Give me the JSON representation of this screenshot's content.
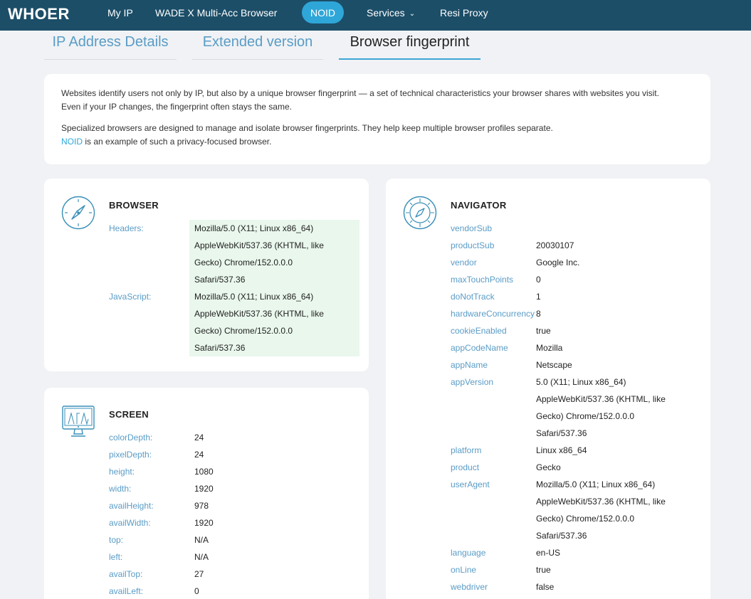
{
  "nav": {
    "logo": "WHOER",
    "links": [
      "My IP",
      "WADE X Multi-Acc Browser",
      "NOID",
      "Services",
      "Resi Proxy"
    ]
  },
  "tabs": [
    "IP Address Details",
    "Extended version",
    "Browser fingerprint"
  ],
  "intro": {
    "p1_line1": "Websites identify users not only by IP, but also by a unique browser fingerprint — a set of technical characteristics your browser shares with websites you visit.",
    "p1_line2": "Even if your IP changes, the fingerprint often stays the same.",
    "p2_line1": "Specialized browsers are designed to manage and isolate browser fingerprints. They help keep multiple browser profiles separate.",
    "p2_link": "NOID",
    "p2_line2_rest": " is an example of such a privacy-focused browser."
  },
  "browser": {
    "title": "BROWSER",
    "headers_label": "Headers:",
    "headers_lines": [
      "Mozilla/5.0 (X11; Linux x86_64)",
      "AppleWebKit/537.36 (KHTML, like",
      "Gecko) Chrome/152.0.0.0",
      "Safari/537.36"
    ],
    "js_label": "JavaScript:",
    "js_lines": [
      "Mozilla/5.0 (X11; Linux x86_64)",
      "AppleWebKit/537.36 (KHTML, like",
      "Gecko) Chrome/152.0.0.0",
      "Safari/537.36"
    ]
  },
  "screen": {
    "title": "SCREEN",
    "rows": [
      {
        "k": "colorDepth:",
        "v": "24"
      },
      {
        "k": "pixelDepth:",
        "v": "24"
      },
      {
        "k": "height:",
        "v": "1080"
      },
      {
        "k": "width:",
        "v": "1920"
      },
      {
        "k": "availHeight:",
        "v": "978"
      },
      {
        "k": "availWidth:",
        "v": "1920"
      },
      {
        "k": "top:",
        "v": "N/A"
      },
      {
        "k": "left:",
        "v": "N/A"
      },
      {
        "k": "availTop:",
        "v": "27"
      },
      {
        "k": "availLeft:",
        "v": "0"
      }
    ]
  },
  "navigator": {
    "title": "NAVIGATOR",
    "rows": [
      {
        "k": "vendorSub",
        "v": ""
      },
      {
        "k": "productSub",
        "v": "20030107"
      },
      {
        "k": "vendor",
        "v": "Google Inc."
      },
      {
        "k": "maxTouchPoints",
        "v": "0"
      },
      {
        "k": "doNotTrack",
        "v": "1"
      },
      {
        "k": "hardwareConcurrency",
        "v": "8"
      },
      {
        "k": "cookieEnabled",
        "v": "true"
      },
      {
        "k": "appCodeName",
        "v": "Mozilla"
      },
      {
        "k": "appName",
        "v": "Netscape"
      },
      {
        "k": "appVersion",
        "v": "5.0 (X11; Linux x86_64)"
      },
      {
        "k": "",
        "v": "AppleWebKit/537.36 (KHTML, like"
      },
      {
        "k": "",
        "v": "Gecko) Chrome/152.0.0.0"
      },
      {
        "k": "",
        "v": "Safari/537.36"
      },
      {
        "k": "platform",
        "v": "Linux x86_64"
      },
      {
        "k": "product",
        "v": "Gecko"
      },
      {
        "k": "userAgent",
        "v": "Mozilla/5.0 (X11; Linux x86_64)"
      },
      {
        "k": "",
        "v": "AppleWebKit/537.36 (KHTML, like"
      },
      {
        "k": "",
        "v": "Gecko) Chrome/152.0.0.0"
      },
      {
        "k": "",
        "v": "Safari/537.36"
      },
      {
        "k": "language",
        "v": "en-US"
      },
      {
        "k": "onLine",
        "v": "true"
      },
      {
        "k": "webdriver",
        "v": "false"
      }
    ]
  },
  "colors": {
    "nav_bg": "#1c4e68",
    "accent": "#2fa6d8",
    "key_text": "#5a9cc6",
    "highlight_bg": "#e9f7ec"
  },
  "icons": [
    "compass-icon",
    "safari-compass-icon",
    "monitor-icon",
    "chevron-down-icon"
  ]
}
